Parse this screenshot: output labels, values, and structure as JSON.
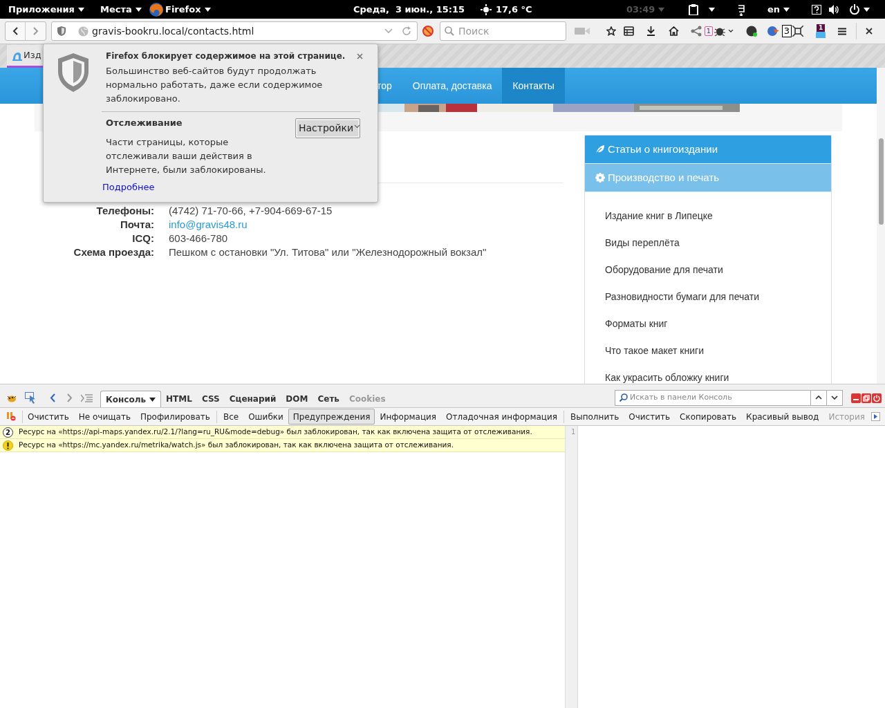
{
  "topbar": {
    "apps": "Приложения",
    "places": "Места",
    "app": "Firefox",
    "clock": "Среда,  3 июн., 15:15",
    "weather": "17,6 °C",
    "timer": "03:49",
    "lang": "en"
  },
  "navbar": {
    "url": "gravis-bookru.local/contacts.html",
    "search": {
      "placeholder": "Поиск"
    },
    "badges": [
      "1",
      "3",
      "1"
    ]
  },
  "tab": {
    "label": "Изд"
  },
  "site": {
    "menu": [
      {
        "label": "тор",
        "selected": false
      },
      {
        "label": "Оплата, доставка",
        "selected": false
      },
      {
        "label": "Контакты",
        "selected": true
      }
    ],
    "contacts": [
      {
        "label": "Телефоны:",
        "value": "(4742) 71-70-66, +7-904-669-67-15",
        "kind": "text"
      },
      {
        "label": "Почта:",
        "value": "info@gravis48.ru",
        "kind": "link"
      },
      {
        "label": "ICQ:",
        "value": "603-466-780",
        "kind": "text"
      },
      {
        "label": "Схема проезда:",
        "value": "Пешком с остановки \"Ул. Титова\" или \"Железнодорожный вокзал\"",
        "kind": "text"
      }
    ],
    "sidebar": {
      "sections": [
        {
          "title": "Статьи о книгоиздании",
          "kind": "leaf",
          "expanded": false
        },
        {
          "title": "Производство и печать",
          "kind": "gear",
          "expanded": true
        }
      ],
      "items": [
        "Издание книг в Липецке",
        "Виды переплёта",
        "Оборудование для печати",
        "Разновидности бумаги для печати",
        "Форматы книг",
        "Что такое макет книги",
        "Как украсить обложку книги"
      ]
    }
  },
  "popup": {
    "title": "Firefox блокирует содержимое на этой странице.",
    "body": "Большинство веб-сайтов будут продолжать нормально работать, даже если содержимое заблокировано.",
    "section_title": "Отслеживание",
    "settings_button": "Настройки",
    "section_body": "Части страницы, которые отслеживали ваши действия в Интернете, были заблокированы.",
    "more_link": "Подробнее"
  },
  "devtools": {
    "tabs": [
      {
        "label": "Консоль",
        "selected": true,
        "disabled": false
      },
      {
        "label": "HTML",
        "selected": false,
        "disabled": false
      },
      {
        "label": "CSS",
        "selected": false,
        "disabled": false
      },
      {
        "label": "Сценарий",
        "selected": false,
        "disabled": false
      },
      {
        "label": "DOM",
        "selected": false,
        "disabled": false
      },
      {
        "label": "Сеть",
        "selected": false,
        "disabled": false
      },
      {
        "label": "Cookies",
        "selected": false,
        "disabled": true
      }
    ],
    "search": {
      "placeholder": "Искать в панели Консоль"
    },
    "toolbar": [
      {
        "label": "Очистить",
        "kind": "command",
        "selected": false,
        "disabled": false
      },
      {
        "label": "Не очищать",
        "kind": "command",
        "selected": false,
        "disabled": false
      },
      {
        "label": "Профилировать",
        "kind": "command",
        "selected": false,
        "disabled": false
      },
      {
        "label": "Все",
        "kind": "filter",
        "selected": false,
        "disabled": false
      },
      {
        "label": "Ошибки",
        "kind": "filter",
        "selected": false,
        "disabled": false
      },
      {
        "label": "Предупреждения",
        "kind": "filter",
        "selected": true,
        "disabled": false
      },
      {
        "label": "Информация",
        "kind": "filter",
        "selected": false,
        "disabled": false
      },
      {
        "label": "Отладочная информация",
        "kind": "filter",
        "selected": false,
        "disabled": false
      },
      {
        "label": "Выполнить",
        "kind": "action",
        "selected": false,
        "disabled": false
      },
      {
        "label": "Очистить",
        "kind": "action",
        "selected": false,
        "disabled": false
      },
      {
        "label": "Скопировать",
        "kind": "action",
        "selected": false,
        "disabled": false
      },
      {
        "label": "Красивый вывод",
        "kind": "action",
        "selected": false,
        "disabled": false
      },
      {
        "label": "История",
        "kind": "action",
        "selected": false,
        "disabled": true
      }
    ],
    "messages": [
      {
        "kind": "count",
        "count": "2",
        "text": "Ресурс на «https://api-maps.yandex.ru/2.1/?lang=ru_RU&mode=debug» был заблокирован, так как включена защита от отслеживания."
      },
      {
        "kind": "warning",
        "text": "Ресурс на «https://mc.yandex.ru/metrika/watch.js» был заблокирован, так как включена защита от отслеживания."
      }
    ],
    "line_number": "1"
  }
}
